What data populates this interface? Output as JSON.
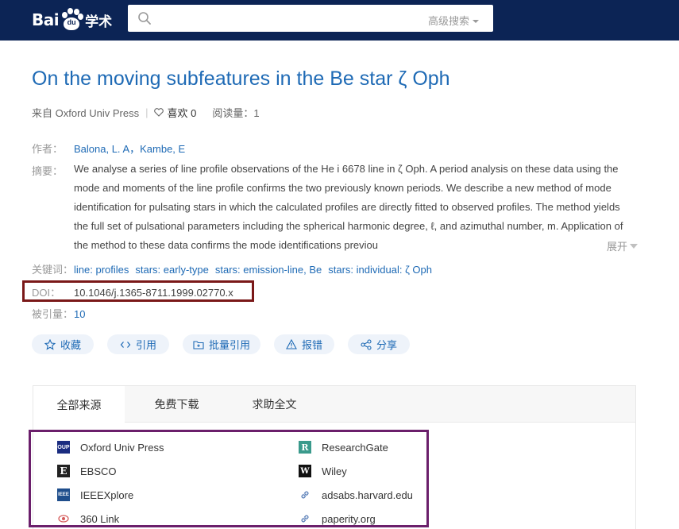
{
  "header": {
    "logo_text": "Bai",
    "logo_du": "du",
    "logo_suffix": "学术",
    "search_value": "",
    "advanced_search": "高级搜索"
  },
  "paper": {
    "title": "On the moving subfeatures in the Be star ζ Oph",
    "source_prefix": "来自 Oxford Univ Press",
    "like_label": "喜欢 0",
    "views_label": "阅读量：1",
    "author_label": "作者：",
    "authors": "Balona, L. A，Kambe, E",
    "abstract_label": "摘要：",
    "abstract": "We analyse a series of line profile observations of the He i 6678 line in ζ Oph. A period analysis on these data using the mode and moments of the line profile confirms the two previously known periods. We describe a new method of mode identification for pulsating stars in which the calculated profiles are directly fitted to observed profiles. The method yields the full set of pulsational parameters including the spherical harmonic degree, ℓ, and azimuthal number, m. Application of the method to these data confirms the mode identifications previou",
    "expand_label": "展开",
    "keywords_label": "关键词：",
    "keywords": [
      "line: profiles",
      "stars: early-type",
      "stars: emission-line, Be",
      "stars: individual: ζ Oph"
    ],
    "doi_label": "DOI：",
    "doi": "10.1046/j.1365-8711.1999.02770.x",
    "cited_label": "被引量：",
    "cited_count": "10"
  },
  "actions": {
    "favorite": "收藏",
    "cite": "引用",
    "batch_cite": "批量引用",
    "report": "报错",
    "share": "分享"
  },
  "tabs": [
    "全部来源",
    "免费下载",
    "求助全文"
  ],
  "sources": {
    "left": [
      "Oxford Univ Press",
      "EBSCO",
      "IEEEXplore",
      "360 Link"
    ],
    "right": [
      "ResearchGate",
      "Wiley",
      "adsabs.harvard.edu",
      "paperity.org"
    ],
    "left_icon_text": [
      "OUP",
      "E",
      "IEEE",
      ""
    ],
    "right_icon_text": [
      "R",
      "W",
      "",
      ""
    ]
  },
  "colors": {
    "header_bg": "#0c2455",
    "link": "#1e6ab5",
    "doi_highlight": "#7a1818",
    "sources_highlight": "#6b1f6b"
  }
}
